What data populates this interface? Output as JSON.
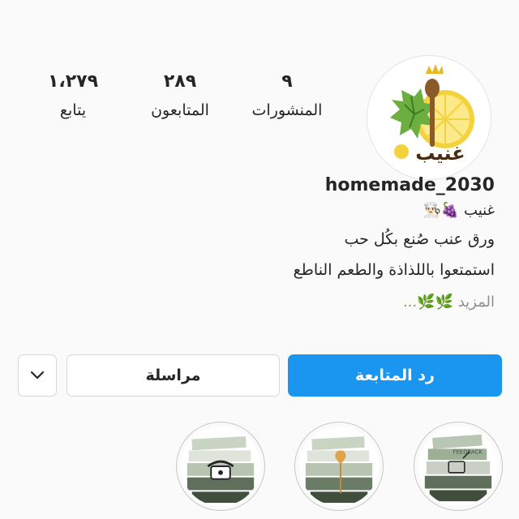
{
  "profile": {
    "avatar_text": "غنيب",
    "avatar_icon": "grape-leaf-lemon-spoon-icon",
    "username": "homemade_2030",
    "display_name": "غنيب 🍇👨🏻‍🍳",
    "bio_lines": [
      "ورق عنب صُنع بكُل حب",
      "استمتعوا باللذاذة والطعم الناطع"
    ],
    "bio_more_emoji": "🌿🌿...",
    "bio_more_label": "المزيد"
  },
  "stats": {
    "posts": {
      "value": "٩",
      "label": "المنشورات"
    },
    "followers": {
      "value": "٢٨٩",
      "label": "المتابعون"
    },
    "following": {
      "value": "١،٢٧٩",
      "label": "يتابع"
    }
  },
  "actions": {
    "follow_back_label": "رد المتابعة",
    "message_label": "مراسلة",
    "more_icon": "chevron-down-icon"
  },
  "highlights": [
    {
      "icon": "feedback-edit-icon",
      "caption": "FEEDBACK"
    },
    {
      "icon": "location-pin-icon"
    },
    {
      "icon": "telephone-icon"
    }
  ],
  "colors": {
    "primary_button": "#1a96f0",
    "background": "#fafafa",
    "muted_text": "#8e8e8e"
  }
}
